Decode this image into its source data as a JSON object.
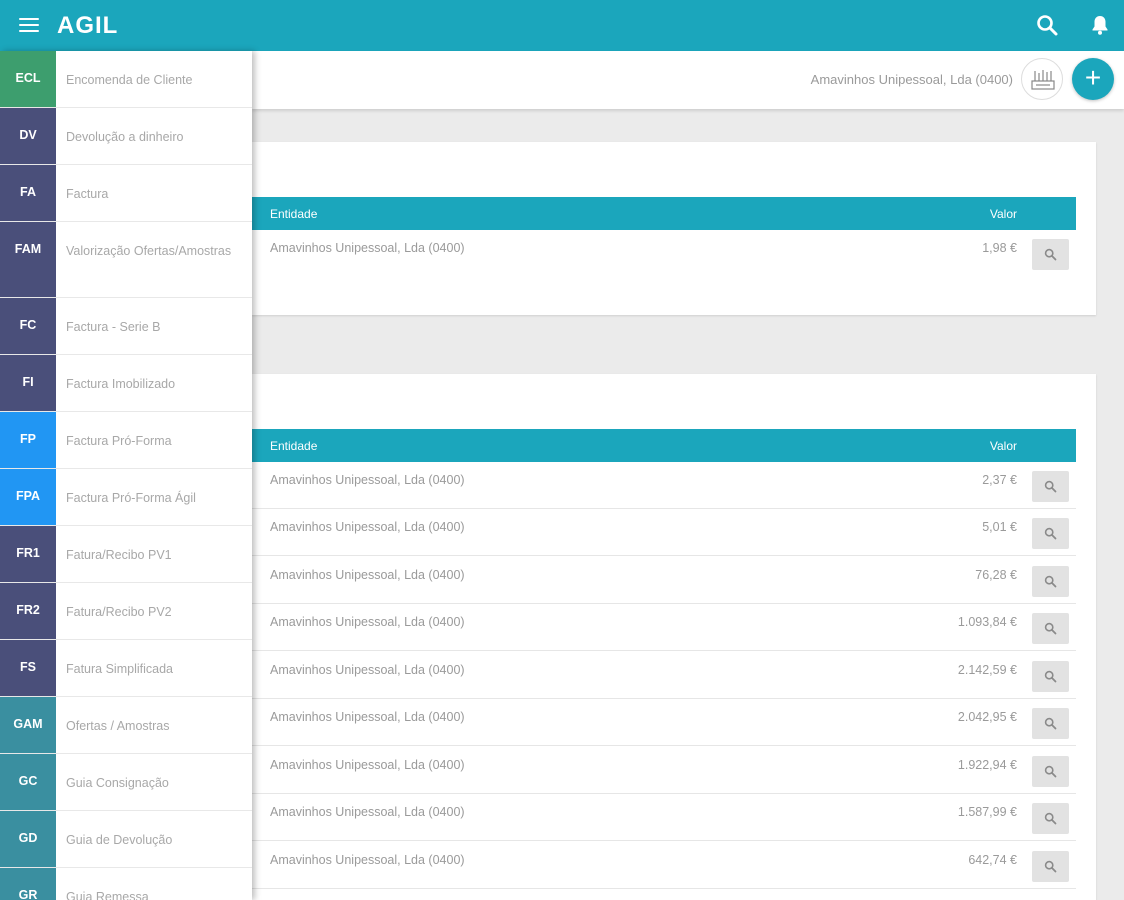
{
  "app": {
    "logo": "AGIL"
  },
  "colors": {
    "primary": "#1ba6bc",
    "ecl": "#3d9e6e",
    "navy": "#4a4f7a",
    "blue": "#2196f3",
    "teal": "#3a8fa0"
  },
  "topbar": {
    "icons": [
      "menu-icon",
      "search-icon",
      "bell-icon"
    ]
  },
  "subheader": {
    "company": "Amavinhos Unipessoal, Lda (0400)",
    "add_label": "+"
  },
  "drawer": {
    "items": [
      {
        "code": "ECL",
        "label": "Encomenda de Cliente"
      },
      {
        "code": "DV",
        "label": "Devolução a dinheiro"
      },
      {
        "code": "FA",
        "label": "Factura"
      },
      {
        "code": "FAM",
        "label": "Valorização Ofertas/Amostras"
      },
      {
        "code": "FC",
        "label": "Factura - Serie B"
      },
      {
        "code": "FI",
        "label": "Factura Imobilizado"
      },
      {
        "code": "FP",
        "label": "Factura Pró-Forma"
      },
      {
        "code": "FPA",
        "label": "Factura Pró-Forma Ágil"
      },
      {
        "code": "FR1",
        "label": "Fatura/Recibo PV1"
      },
      {
        "code": "FR2",
        "label": "Fatura/Recibo PV2"
      },
      {
        "code": "FS",
        "label": "Fatura Simplificada"
      },
      {
        "code": "GAM",
        "label": "Ofertas / Amostras"
      },
      {
        "code": "GC",
        "label": "Guia Consignação"
      },
      {
        "code": "GD",
        "label": "Guia de Devolução"
      },
      {
        "code": "GR",
        "label": "Guia Remessa"
      }
    ]
  },
  "card1": {
    "col_entity": "Entidade",
    "col_value": "Valor",
    "rows": [
      {
        "entity": "Amavinhos Unipessoal, Lda (0400)",
        "value": "1,98 €"
      }
    ]
  },
  "card2": {
    "col_entity": "Entidade",
    "col_value": "Valor",
    "rows": [
      {
        "entity": "Amavinhos Unipessoal, Lda (0400)",
        "value": "2,37 €"
      },
      {
        "entity": "Amavinhos Unipessoal, Lda (0400)",
        "value": "5,01 €"
      },
      {
        "entity": "Amavinhos Unipessoal, Lda (0400)",
        "value": "76,28 €"
      },
      {
        "entity": "Amavinhos Unipessoal, Lda (0400)",
        "value": "1.093,84 €"
      },
      {
        "entity": "Amavinhos Unipessoal, Lda (0400)",
        "value": "2.142,59 €"
      },
      {
        "entity": "Amavinhos Unipessoal, Lda (0400)",
        "value": "2.042,95 €"
      },
      {
        "entity": "Amavinhos Unipessoal, Lda (0400)",
        "value": "1.922,94 €"
      },
      {
        "entity": "Amavinhos Unipessoal, Lda (0400)",
        "value": "1.587,99 €"
      },
      {
        "entity": "Amavinhos Unipessoal, Lda (0400)",
        "value": "642,74 €"
      }
    ]
  }
}
